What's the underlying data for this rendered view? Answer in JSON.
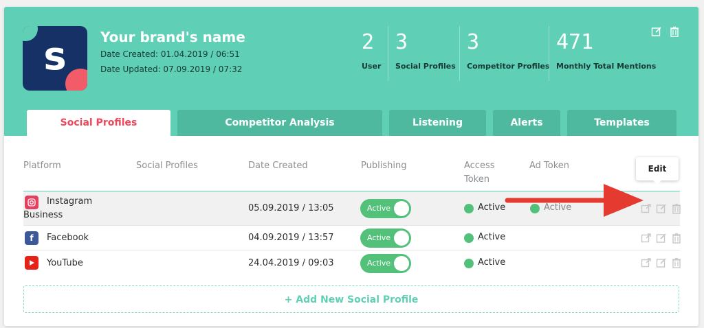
{
  "brand": {
    "logo_letter": "s",
    "name": "Your brand's name",
    "date_created": "Date Created: 01.04.2019 / 06:51",
    "date_updated": "Date Updated: 07.09.2019 / 07:32"
  },
  "stats": [
    {
      "value": "2",
      "label": "User"
    },
    {
      "value": "3",
      "label": "Social Profiles"
    },
    {
      "value": "3",
      "label": "Competitor Profiles"
    },
    {
      "value": "471",
      "label": "Monthly Total Mentions"
    }
  ],
  "header_icons": [
    "edit-icon",
    "trash-icon"
  ],
  "tabs": [
    {
      "label": "Social Profiles",
      "active": true
    },
    {
      "label": "Competitor Analysis",
      "active": false
    },
    {
      "label": "Listening",
      "active": false
    },
    {
      "label": "Alerts",
      "active": false
    },
    {
      "label": "Templates",
      "active": false
    }
  ],
  "table": {
    "headers": {
      "platform": "Platform",
      "social_profiles": "Social Profiles",
      "date_created": "Date Created",
      "publishing": "Publishing",
      "access_token_1": "Access",
      "access_token_2": "Token",
      "ad_token": "Ad Token"
    },
    "rows": [
      {
        "platform": "Instagram",
        "platform_sub": "Business",
        "date": "05.09.2019 / 13:05",
        "publishing": "Active",
        "access_token": "Active",
        "ad_token": "Active"
      },
      {
        "platform": "Facebook",
        "date": "04.09.2019 / 13:57",
        "publishing": "Active",
        "access_token": "Active"
      },
      {
        "platform": "YouTube",
        "date": "24.04.2019 / 09:03",
        "publishing": "Active",
        "access_token": "Active"
      }
    ]
  },
  "add_profile_label": "+ Add New Social Profile",
  "tooltip_label": "Edit",
  "colors": {
    "header": "#5fcfb5",
    "tab_inactive": "#4fb9a0",
    "accent_red": "#f0475a",
    "toggle_green": "#54c17a",
    "logo_navy": "#163165"
  }
}
